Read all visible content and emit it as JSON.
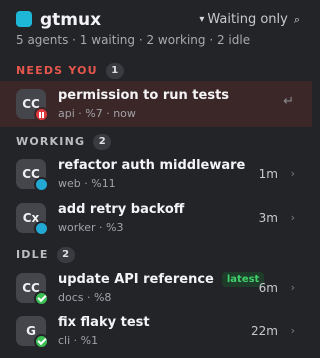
{
  "app": {
    "title": "gtmux"
  },
  "filter": {
    "label": "Waiting only",
    "caret": "▾",
    "search_glyph": "⌕"
  },
  "summary": "5 agents · 1 waiting · 2 working · 2 idle",
  "sections": {
    "needs_you": {
      "label": "NEEDS YOU",
      "count": "1",
      "color": "#e5574d"
    },
    "working": {
      "label": "WORKING",
      "count": "2",
      "color": "#bdbdc2"
    },
    "idle": {
      "label": "IDLE",
      "count": "2",
      "color": "#bdbdc2"
    }
  },
  "agents": [
    {
      "avatar": "CC",
      "title": "permission to run tests",
      "meta": "api · %7 · now",
      "status": "blocked",
      "action_glyph": "↵"
    },
    {
      "avatar": "CC",
      "title": "refactor auth middleware",
      "meta": "web · %11",
      "status": "working",
      "elapsed": "1m",
      "chevron": "›"
    },
    {
      "avatar": "Cx",
      "title": "add retry backoff",
      "meta": "worker · %3",
      "status": "working",
      "elapsed": "3m",
      "chevron": "›"
    },
    {
      "avatar": "CC",
      "title": "update API reference",
      "tag": "latest",
      "meta": "docs · %8",
      "status": "idle",
      "elapsed": "6m",
      "chevron": "›"
    },
    {
      "avatar": "G",
      "title": "fix flaky test",
      "meta": "cli · %1",
      "status": "idle",
      "elapsed": "22m",
      "chevron": "›"
    }
  ],
  "colors": {
    "background": "#232428",
    "accent": "#1fb7d8",
    "highlight_row": "#3b2727",
    "status_blocked": "#e0383f",
    "status_working": "#22a9d3",
    "status_idle": "#3cbf55",
    "tag_latest": "#3fd06b"
  }
}
